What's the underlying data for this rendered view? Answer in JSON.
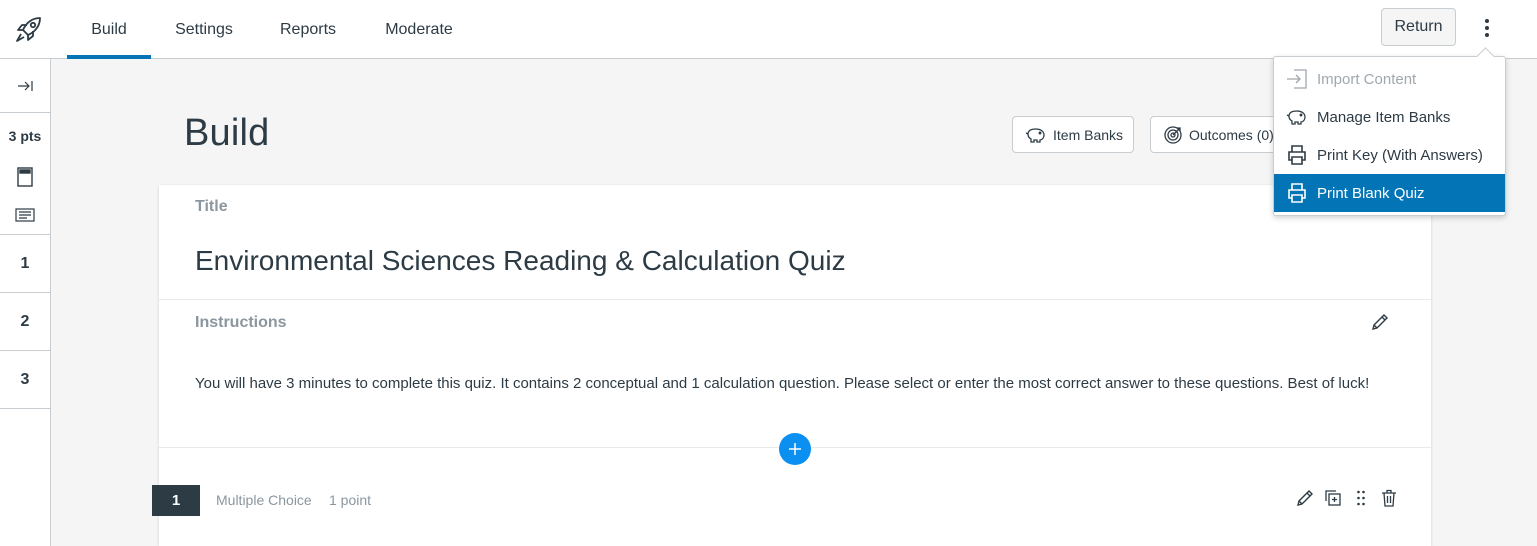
{
  "nav": {
    "tabs": [
      {
        "label": "Build",
        "active": true
      },
      {
        "label": "Settings",
        "active": false
      },
      {
        "label": "Reports",
        "active": false
      },
      {
        "label": "Moderate",
        "active": false
      }
    ],
    "return_label": "Return",
    "logo_icon": "rocket-icon",
    "more_icon": "kebab-vertical-icon"
  },
  "rail": {
    "expand_icon": "expand-right-icon",
    "points": "3 pts",
    "stimulus_icon": "stimulus-icon",
    "text_block_icon": "text-block-icon",
    "questions": [
      "1",
      "2",
      "3"
    ]
  },
  "main": {
    "heading": "Build",
    "item_banks_label": "Item Banks",
    "outcomes_label": "Outcomes (0)"
  },
  "card": {
    "title_label": "Title",
    "title": "Environmental Sciences Reading & Calculation Quiz",
    "instructions_label": "Instructions",
    "instructions": "You will have 3 minutes to complete this quiz. It contains 2 conceptual and 1 calculation question. Please select or enter the most correct answer to these questions. Best of luck!",
    "question": {
      "number": "1",
      "type": "Multiple Choice",
      "points": "1 point"
    }
  },
  "menu": {
    "items": [
      {
        "label": "Import Content",
        "icon": "import-icon",
        "disabled": true
      },
      {
        "label": "Manage Item Banks",
        "icon": "piggy-bank-icon"
      },
      {
        "label": "Print Key (With Answers)",
        "icon": "printer-icon"
      },
      {
        "label": "Print Blank Quiz",
        "icon": "printer-icon",
        "selected": true
      }
    ]
  },
  "colors": {
    "accent": "#0374b5",
    "add_button": "#0b8ff0",
    "text": "#2d3b45",
    "muted": "#8b969e"
  }
}
